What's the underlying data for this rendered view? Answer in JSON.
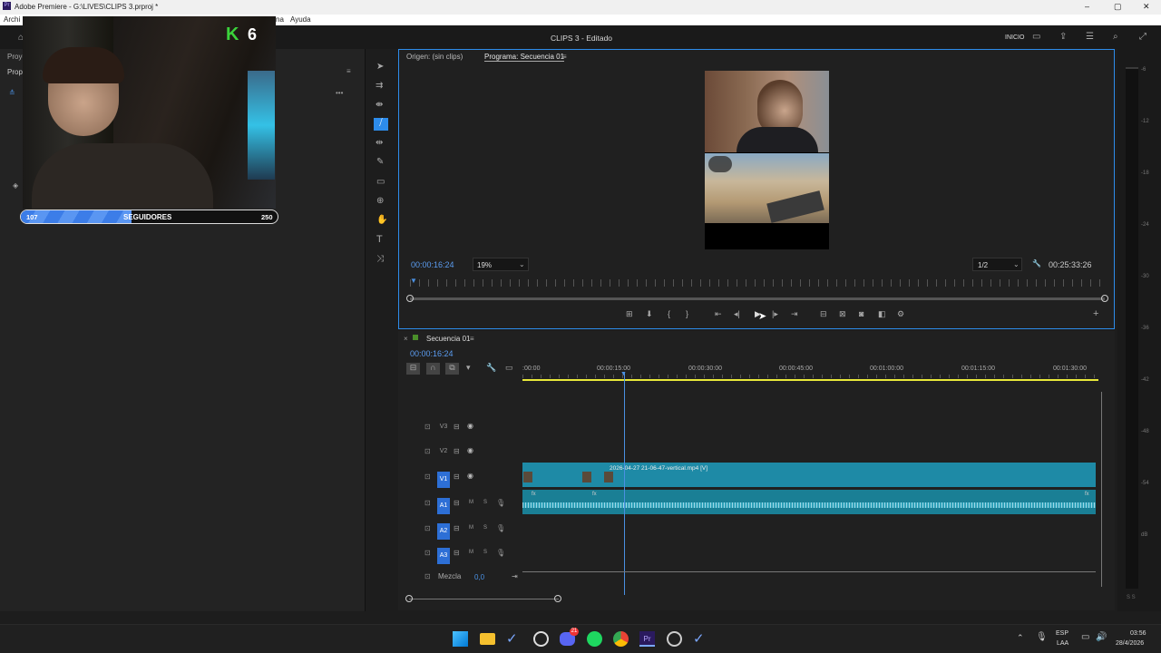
{
  "window": {
    "title": "Adobe Premiere - G:\\LIVES\\CLIPS 3.prproj *",
    "menu_left": "Archi",
    "menu_help": "Ayuda",
    "menu_partial": "na"
  },
  "topbar": {
    "doc_title": "CLIPS 3 - Editado",
    "workspace": "INICIO"
  },
  "left": {
    "tab1": "Proye",
    "tab2": "Propi"
  },
  "overlay": {
    "kill_count": "6",
    "followers_current": "107",
    "followers_label": "SEGUIDORES",
    "followers_goal": "250",
    "followers_progress": 0.43
  },
  "monitor": {
    "tab_source": "Origen: (sin clips)",
    "tab_program": "Programa: Secuencia 01",
    "timecode": "00:00:16:24",
    "zoom": "19%",
    "resolution": "1/2",
    "duration": "00:25:33:26"
  },
  "timeline": {
    "sequence_name": "Secuencia 01",
    "timecode": "00:00:16:24",
    "ruler": [
      ":00:00",
      "00:00:15:00",
      "00:00:30:00",
      "00:00:45:00",
      "00:01:00:00",
      "00:01:15:00",
      "00:01:30:00"
    ],
    "tracks": [
      "V3",
      "V2",
      "V1",
      "A1",
      "A2",
      "A3"
    ],
    "clip_name": "2026-04-27 21-06-47-vertical.mp4 [V]",
    "mix_label": "Mezcla",
    "mix_value": "0,0"
  },
  "meter": {
    "ticks": [
      "-6",
      "-12",
      "-18",
      "-24",
      "-30",
      "-36",
      "-42",
      "-48",
      "-54",
      "dB"
    ],
    "footer": "S S"
  },
  "taskbar": {
    "lang1": "ESP",
    "lang2": "LAA",
    "time": "03:56",
    "date": "28/4/2026",
    "notif": "21"
  }
}
